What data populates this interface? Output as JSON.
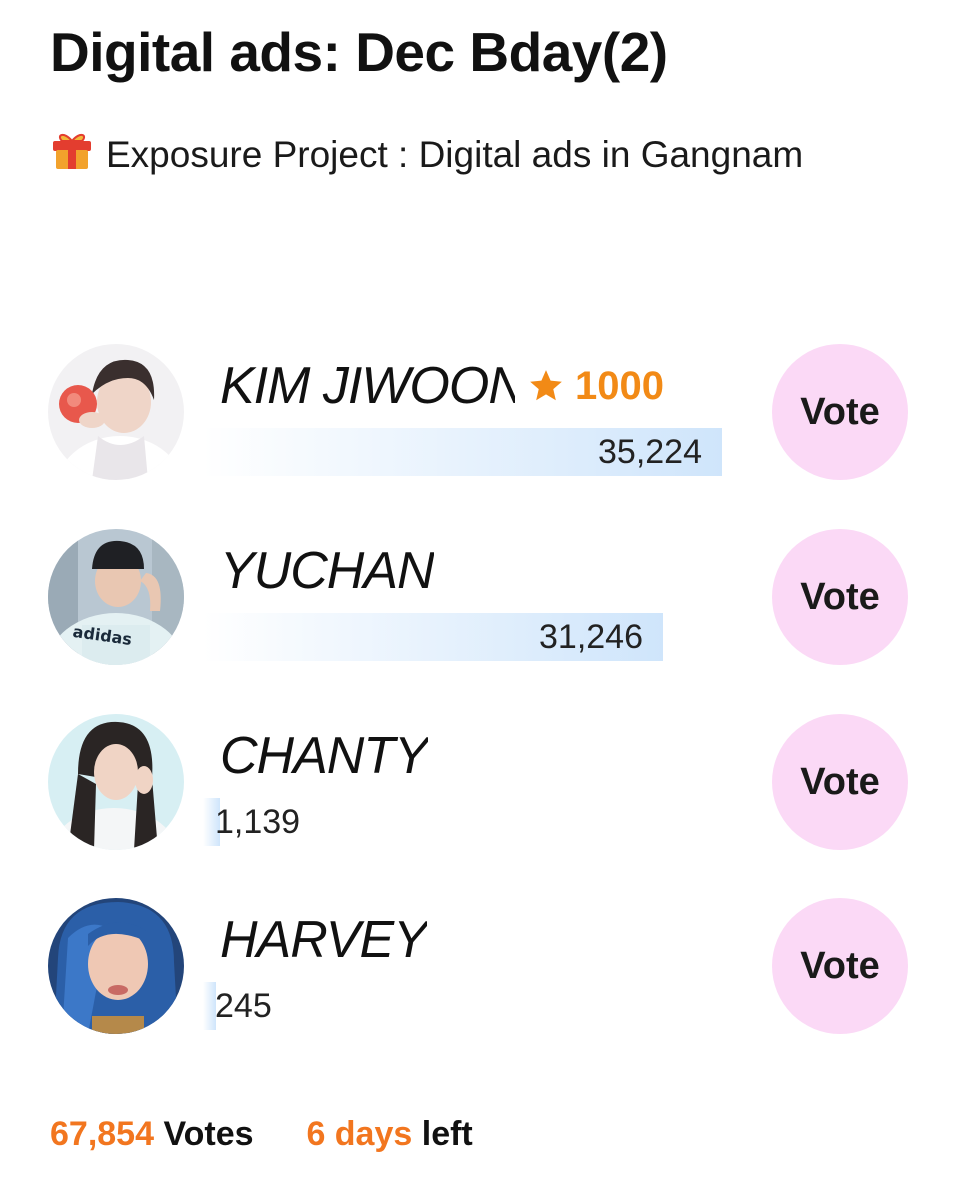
{
  "page": {
    "title": "Digital ads: Dec Bday(2)",
    "subtitle": "Exposure Project : Digital ads in Gangnam",
    "subtitle_icon": "gift-icon"
  },
  "colors": {
    "accent": "#f2761f",
    "badge": "#f28a16",
    "vote_button_bg": "#fbd9f6",
    "bar": "#cfe5fb"
  },
  "candidates": [
    {
      "name": "KIM JIWOON",
      "badge_icon": "star-icon",
      "badge_value": "1000",
      "votes": "35,224",
      "vote_label": "Vote",
      "share": 0.519
    },
    {
      "name": "YUCHAN",
      "votes": "31,246",
      "vote_label": "Vote",
      "share": 0.46
    },
    {
      "name": "CHANTY",
      "votes": "1,139",
      "vote_label": "Vote",
      "share": 0.017
    },
    {
      "name": "HARVEY",
      "votes": "245",
      "vote_label": "Vote",
      "share": 0.004
    }
  ],
  "footer": {
    "total_votes": "67,854",
    "votes_label": "Votes",
    "days": "6 days",
    "left_label": "left"
  }
}
